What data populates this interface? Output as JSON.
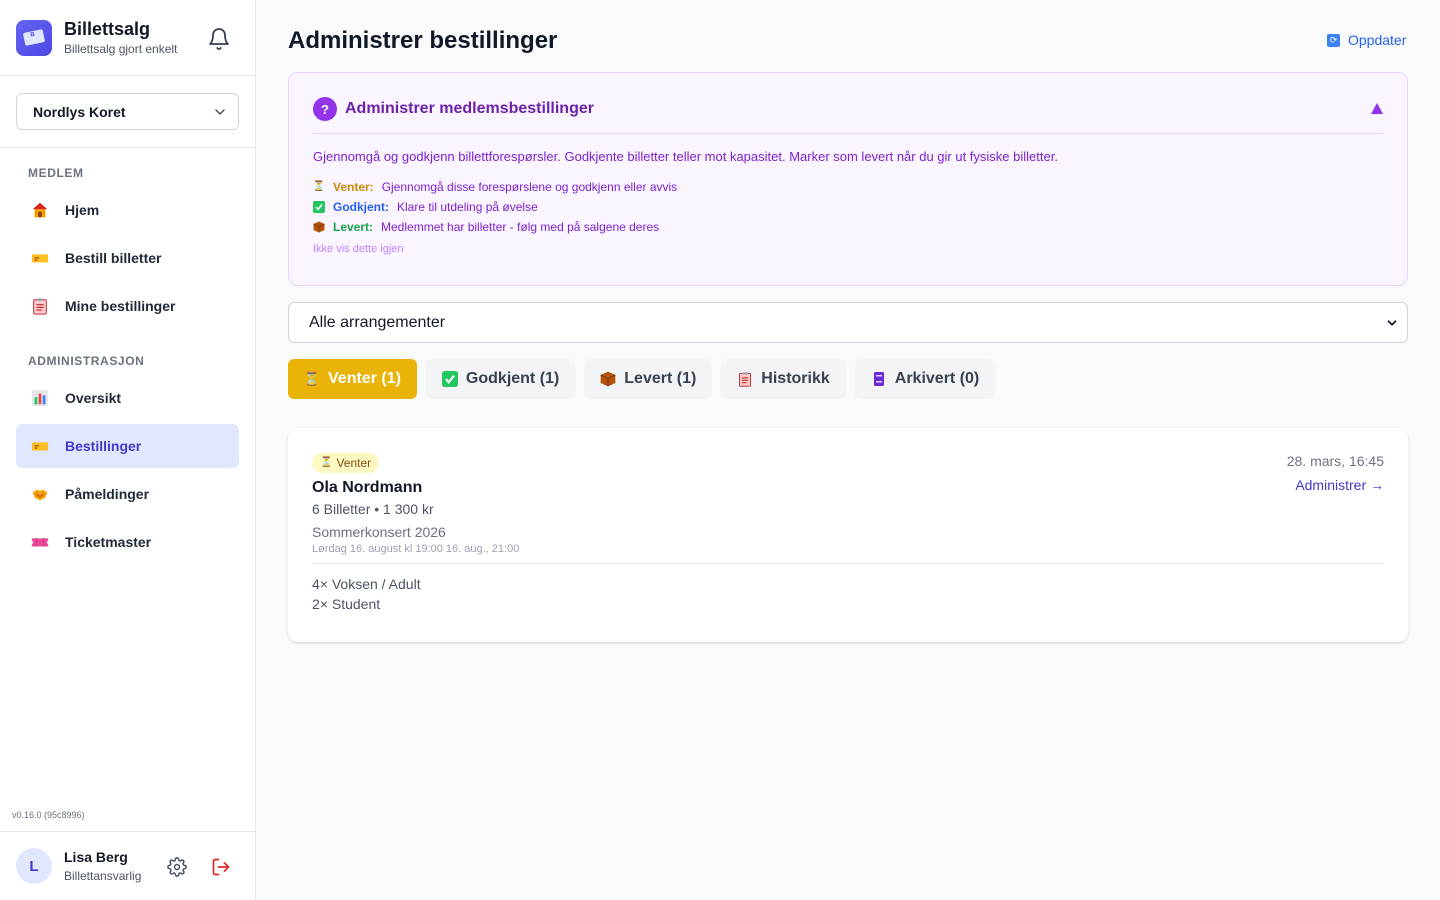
{
  "brand": {
    "title": "Billettsalg",
    "subtitle": "Billettsalg gjort enkelt"
  },
  "org_select": {
    "value": "Nordlys Koret"
  },
  "sidebar": {
    "member_section": "MEDLEM",
    "member_items": [
      {
        "label": "Hjem",
        "icon": "house-icon"
      },
      {
        "label": "Bestill billetter",
        "icon": "ticket-icon"
      },
      {
        "label": "Mine bestillinger",
        "icon": "clipboard-icon"
      }
    ],
    "admin_section": "ADMINISTRASJON",
    "admin_items": [
      {
        "label": "Oversikt",
        "icon": "bar-chart-icon"
      },
      {
        "label": "Bestillinger",
        "icon": "ticket-icon",
        "active": true
      },
      {
        "label": "Påmeldinger",
        "icon": "handshake-icon"
      },
      {
        "label": "Ticketmaster",
        "icon": "ticket-pink-icon"
      }
    ]
  },
  "version": "v0.16.0 (95c8996)",
  "user": {
    "initial": "L",
    "name": "Lisa Berg",
    "role": "Billettansvarlig"
  },
  "page": {
    "title": "Administrer bestillinger",
    "refresh_label": "Oppdater"
  },
  "info": {
    "title": "Administrer medlemsbestillinger",
    "description": "Gjennomgå og godkjenn billettforespørsler. Godkjente billetter teller mot kapasitet. Marker som levert når du gir ut fysiske billetter.",
    "legend": [
      {
        "key": "Venter:",
        "text": "Gjennomgå disse forespørslene og godkjenn eller avvis"
      },
      {
        "key": "Godkjent:",
        "text": "Klare til utdeling på øvelse"
      },
      {
        "key": "Levert:",
        "text": "Medlemmet har billetter - følg med på salgene deres"
      }
    ],
    "dismiss": "Ikke vis dette igjen"
  },
  "event_filter": {
    "value": "Alle arrangementer"
  },
  "tabs": [
    {
      "label": "Venter (1)",
      "active": true
    },
    {
      "label": "Godkjent (1)"
    },
    {
      "label": "Levert (1)"
    },
    {
      "label": "Historikk"
    },
    {
      "label": "Arkivert (0)"
    }
  ],
  "order": {
    "status": "Venter",
    "name": "Ola Nordmann",
    "meta": "6 Billetter • 1 300 kr",
    "event": "Sommerkonsert 2026",
    "event_time": "Lørdag 16. august kl 19:00 16. aug., 21:00",
    "date": "28. mars, 16:45",
    "manage_label": "Administrer →",
    "items": [
      "4× Voksen / Adult",
      "2× Student"
    ]
  },
  "colors": {
    "accent": "#4338ca",
    "pending": "#eab308",
    "info_bg": "#faf5ff",
    "info_text": "#7e22ce"
  }
}
